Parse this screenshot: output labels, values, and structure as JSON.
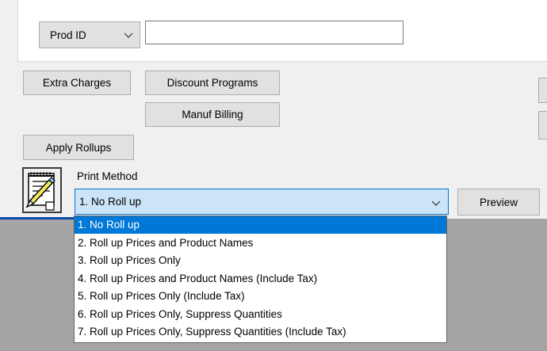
{
  "search": {
    "field_select_value": "Prod ID",
    "input_value": ""
  },
  "buttons": {
    "extra_charges": "Extra Charges",
    "discount_programs": "Discount Programs",
    "manuf_billing": "Manuf Billing",
    "apply_rollups": "Apply Rollups",
    "preview": "Preview"
  },
  "print_method": {
    "label": "Print Method",
    "selected": "1. No Roll up",
    "options": [
      "1. No Roll up",
      "2. Roll up Prices and Product Names",
      "3. Roll up Prices Only",
      "4. Roll up Prices and Product Names (Include Tax)",
      "5. Roll up Prices Only (Include Tax)",
      "6. Roll up Prices Only, Suppress Quantities",
      "7. Roll up Prices Only, Suppress Quantities (Include Tax)"
    ]
  },
  "icons": {
    "notepad": "notepad-pencil-icon",
    "chevron": "chevron-down-icon"
  },
  "colors": {
    "selection": "#0078d7",
    "focus_fill": "#cce4f7",
    "panel": "#f0f0f0",
    "backdrop": "#a4a4a4"
  }
}
